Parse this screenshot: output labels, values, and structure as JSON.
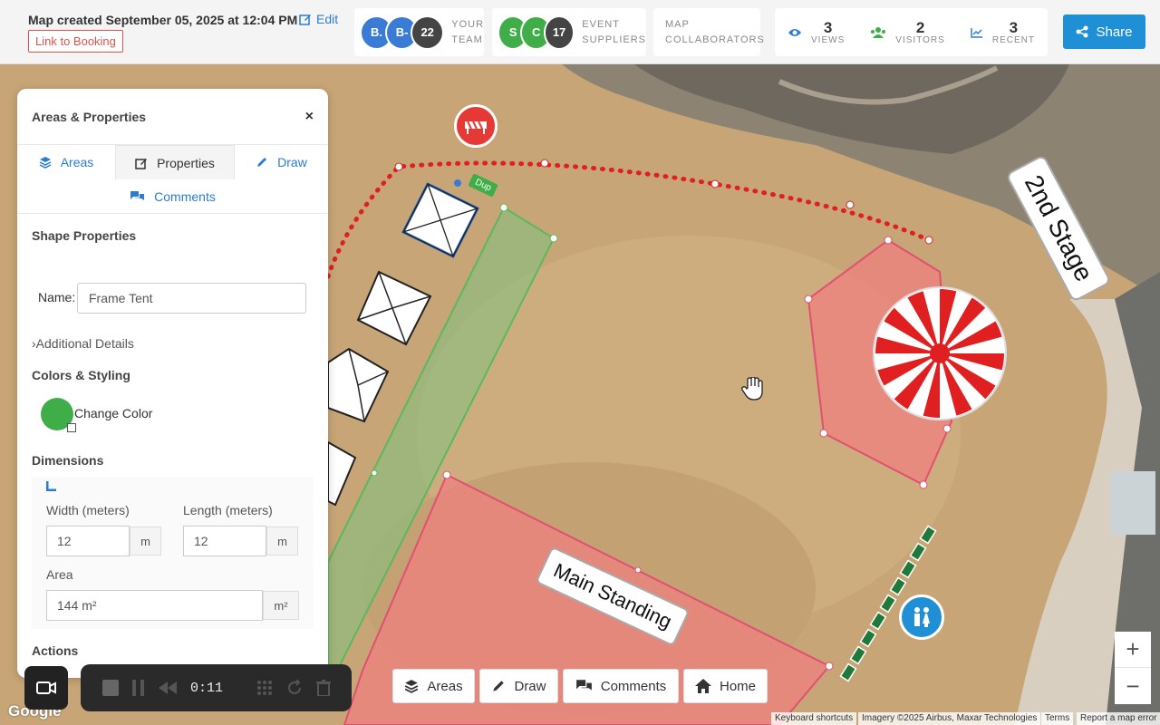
{
  "header": {
    "map_created": "Map created September 05, 2025 at 12:04 PM",
    "edit_label": "Edit",
    "booking_label": "Link to Booking",
    "team": {
      "avatars": [
        "B.",
        "B-"
      ],
      "count": "22",
      "label_1": "YOUR",
      "label_2": "TEAM"
    },
    "suppliers": {
      "avatars": [
        "S",
        "C"
      ],
      "count": "17",
      "label_1": "EVENT",
      "label_2": "SUPPLIERS"
    },
    "collaborators": {
      "label_1": "MAP",
      "label_2": "COLLABORATORS"
    },
    "stats": {
      "views": {
        "value": "3",
        "label": "VIEWS"
      },
      "visitors": {
        "value": "2",
        "label": "VISITORS"
      },
      "recent": {
        "value": "3",
        "label": "RECENT"
      }
    },
    "share_label": "Share"
  },
  "panel": {
    "title": "Areas & Properties",
    "close": "×",
    "tabs": {
      "areas": "Areas",
      "properties": "Properties",
      "draw": "Draw",
      "comments": "Comments"
    },
    "shape_properties": "Shape Properties",
    "name_label": "Name:",
    "name_value": "Frame Tent",
    "additional_details": "Additional Details",
    "colors_styling": "Colors & Styling",
    "change_color": "Change Color",
    "shape_color": "#3fae49",
    "dimensions": "Dimensions",
    "width_label": "Width (meters)",
    "width_value": "12",
    "width_unit": "m",
    "length_label": "Length (meters)",
    "length_value": "12",
    "length_unit": "m",
    "area_label": "Area",
    "area_value": "144 m²",
    "area_unit": "m²",
    "actions": "Actions"
  },
  "map": {
    "dup_label": "Dup",
    "main_standing": "Main Standing",
    "second_stage": "2nd Stage"
  },
  "recorder": {
    "time": "0:11"
  },
  "toolbar": {
    "areas": "Areas",
    "draw": "Draw",
    "comments": "Comments",
    "home": "Home"
  },
  "zoom": {
    "in": "+",
    "out": "−"
  },
  "attribution": {
    "google": "Google",
    "shortcuts": "Keyboard shortcuts",
    "imagery": "Imagery ©2025 Airbus, Maxar Technologies",
    "terms": "Terms",
    "report": "Report a map error"
  },
  "colors": {
    "accent": "#1f8fd6",
    "link": "#2b7cd3",
    "fence": "#e02020",
    "zone_red": "#f08080",
    "zone_green": "#5cb85c"
  }
}
